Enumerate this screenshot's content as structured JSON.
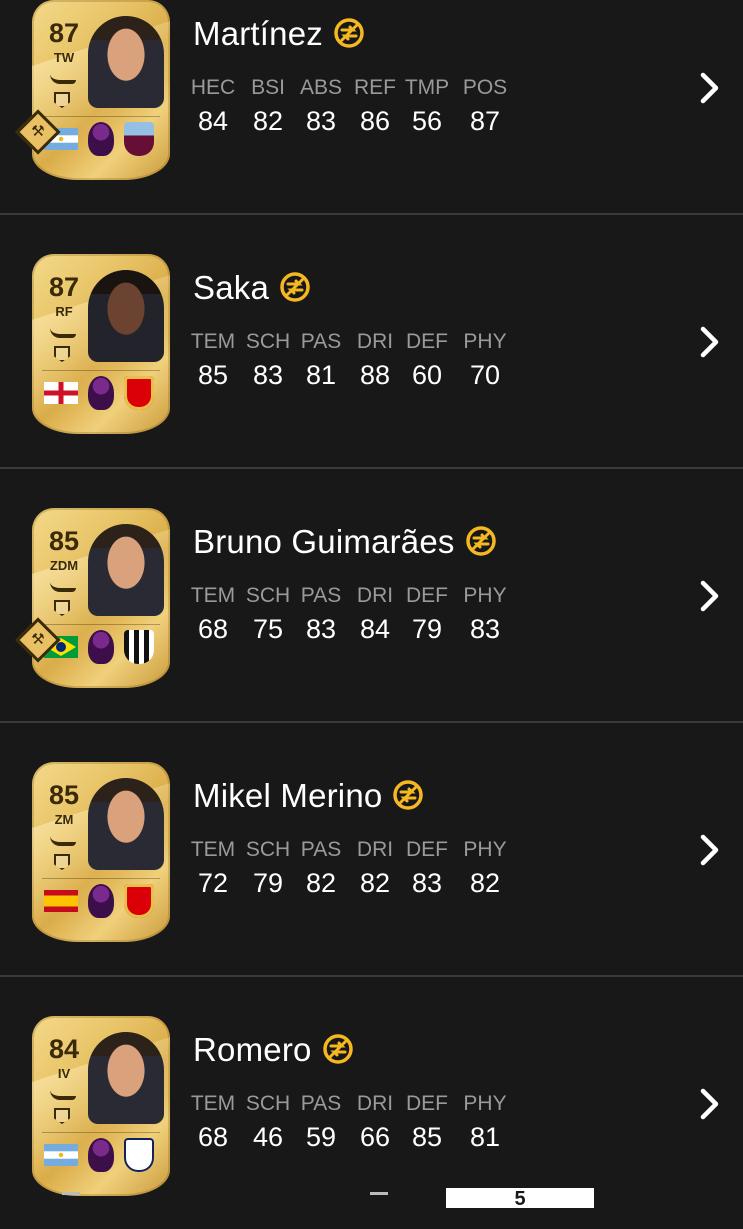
{
  "players": [
    {
      "name": "Martínez",
      "rating": "87",
      "position": "TW",
      "stat_labels": [
        "HEC",
        "BSI",
        "ABS",
        "REF",
        "TMP",
        "POS"
      ],
      "stat_values": [
        "84",
        "82",
        "83",
        "86",
        "56",
        "87"
      ],
      "has_playstyle_badge": true,
      "nation": "argentina",
      "club": "aston-villa"
    },
    {
      "name": "Saka",
      "rating": "87",
      "position": "RF",
      "stat_labels": [
        "TEM",
        "SCH",
        "PAS",
        "DRI",
        "DEF",
        "PHY"
      ],
      "stat_values": [
        "85",
        "83",
        "81",
        "88",
        "60",
        "70"
      ],
      "has_playstyle_badge": false,
      "nation": "england",
      "club": "arsenal"
    },
    {
      "name": "Bruno Guimarães",
      "rating": "85",
      "position": "ZDM",
      "stat_labels": [
        "TEM",
        "SCH",
        "PAS",
        "DRI",
        "DEF",
        "PHY"
      ],
      "stat_values": [
        "68",
        "75",
        "83",
        "84",
        "79",
        "83"
      ],
      "has_playstyle_badge": true,
      "nation": "brazil",
      "club": "newcastle"
    },
    {
      "name": "Mikel Merino",
      "rating": "85",
      "position": "ZM",
      "stat_labels": [
        "TEM",
        "SCH",
        "PAS",
        "DRI",
        "DEF",
        "PHY"
      ],
      "stat_values": [
        "72",
        "79",
        "82",
        "82",
        "83",
        "82"
      ],
      "has_playstyle_badge": false,
      "nation": "spain",
      "club": "arsenal"
    },
    {
      "name": "Romero",
      "rating": "84",
      "position": "IV",
      "stat_labels": [
        "TEM",
        "SCH",
        "PAS",
        "DRI",
        "DEF",
        "PHY"
      ],
      "stat_values": [
        "68",
        "46",
        "59",
        "66",
        "85",
        "81"
      ],
      "has_playstyle_badge": false,
      "nation": "argentina",
      "club": "tottenham"
    }
  ],
  "icons": {
    "untradeable": "untradeable-icon",
    "chevron": "chevron-right-icon"
  },
  "colors": {
    "background": "#181818",
    "untradeable_gold": "#f5b820",
    "stat_label": "#9a9a9a",
    "divider": "#3a3a3a"
  },
  "pagination": {
    "current_page": "5"
  }
}
